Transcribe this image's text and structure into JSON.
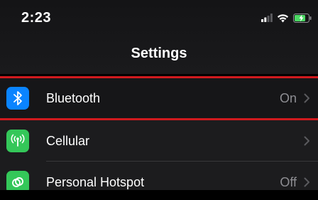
{
  "status_bar": {
    "time": "2:23",
    "signal_icon": "cellular-signal-icon",
    "wifi_icon": "wifi-icon",
    "battery_icon": "battery-charging-icon",
    "battery_color": "#4cd964"
  },
  "nav": {
    "title": "Settings"
  },
  "rows": [
    {
      "label": "Bluetooth",
      "value": "On",
      "icon": "bluetooth-icon",
      "icon_color": "#0a84ff",
      "highlighted": true
    },
    {
      "label": "Cellular",
      "value": "",
      "icon": "cellular-antenna-icon",
      "icon_color": "#34c759",
      "highlighted": false
    },
    {
      "label": "Personal Hotspot",
      "value": "Off",
      "icon": "hotspot-icon",
      "icon_color": "#34c759",
      "highlighted": false
    }
  ],
  "colors": {
    "highlight_border": "#d01a1e",
    "chevron": "#5a5a5e",
    "secondary_text": "#8e8e93"
  }
}
